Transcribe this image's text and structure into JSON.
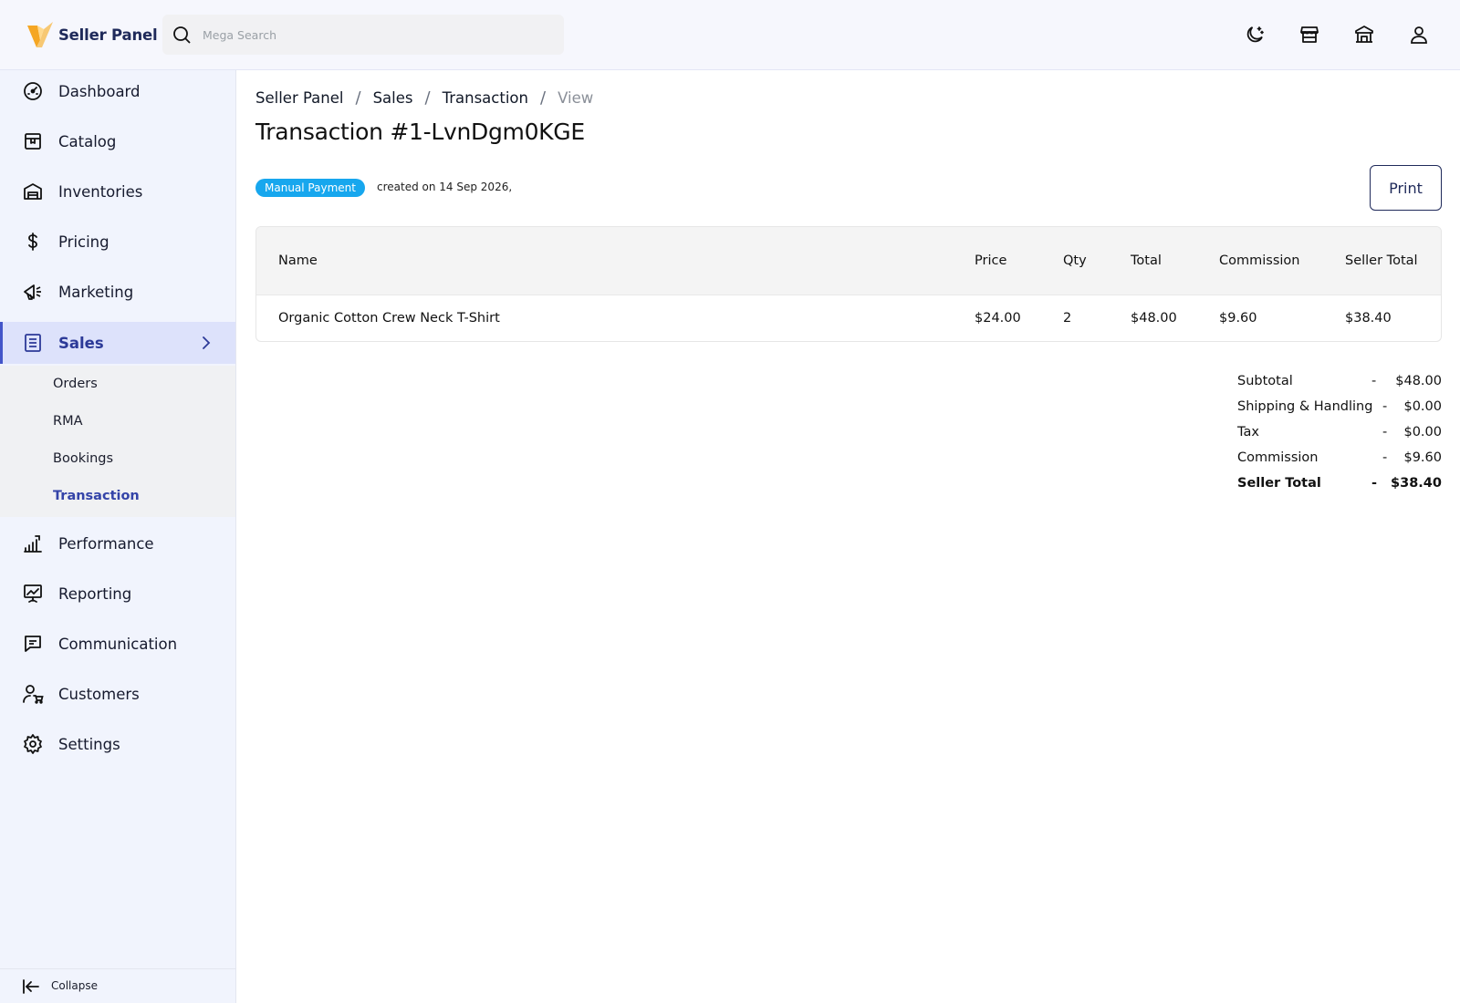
{
  "header": {
    "brand_name": "Seller Panel",
    "search_placeholder": "Mega Search",
    "icons": [
      "moon-icon",
      "store-icon",
      "institution-icon",
      "user-icon"
    ]
  },
  "sidebar": {
    "items": [
      {
        "label": "Dashboard",
        "icon": "gauge-icon"
      },
      {
        "label": "Catalog",
        "icon": "box-icon"
      },
      {
        "label": "Inventories",
        "icon": "warehouse-icon"
      },
      {
        "label": "Pricing",
        "icon": "dollar-icon"
      },
      {
        "label": "Marketing",
        "icon": "megaphone-icon"
      },
      {
        "label": "Sales",
        "icon": "document-icon",
        "active": true
      },
      {
        "label": "Performance",
        "icon": "bar-chart-icon"
      },
      {
        "label": "Reporting",
        "icon": "presentation-icon"
      },
      {
        "label": "Communication",
        "icon": "chat-icon"
      },
      {
        "label": "Customers",
        "icon": "customers-icon"
      },
      {
        "label": "Settings",
        "icon": "gear-icon"
      }
    ],
    "sub_items": [
      {
        "label": "Orders"
      },
      {
        "label": "RMA"
      },
      {
        "label": "Bookings"
      },
      {
        "label": "Transaction",
        "active": true
      }
    ],
    "collapse_label": "Collapse"
  },
  "breadcrumb": [
    "Seller Panel",
    "Sales",
    "Transaction",
    "View"
  ],
  "page_title": "Transaction #1-LvnDgm0KGE",
  "badge": "Manual Payment",
  "created_text": "created on 14 Sep 2026,",
  "print_label": "Print",
  "table": {
    "columns": [
      "Name",
      "Price",
      "Qty",
      "Total",
      "Commission",
      "Seller Total"
    ],
    "rows": [
      [
        "Organic Cotton Crew Neck T-Shirt",
        "$24.00",
        "2",
        "$48.00",
        "$9.60",
        "$38.40"
      ]
    ]
  },
  "totals": [
    {
      "label": "Subtotal",
      "sep": "-",
      "value": "$48.00"
    },
    {
      "label": "Shipping & Handling",
      "sep": "-",
      "value": "$0.00"
    },
    {
      "label": "Tax",
      "sep": "-",
      "value": "$0.00"
    },
    {
      "label": "Commission",
      "sep": "-",
      "value": "$9.60"
    },
    {
      "label": "Seller Total",
      "sep": "-",
      "value": "$38.40",
      "bold": true
    }
  ],
  "colors": {
    "accent": "#4355c9",
    "badge": "#17a7ee",
    "brand_text": "#1f2a5a",
    "sidebar_bg": "#f1f4fd",
    "active_bg": "#dde2fb"
  }
}
